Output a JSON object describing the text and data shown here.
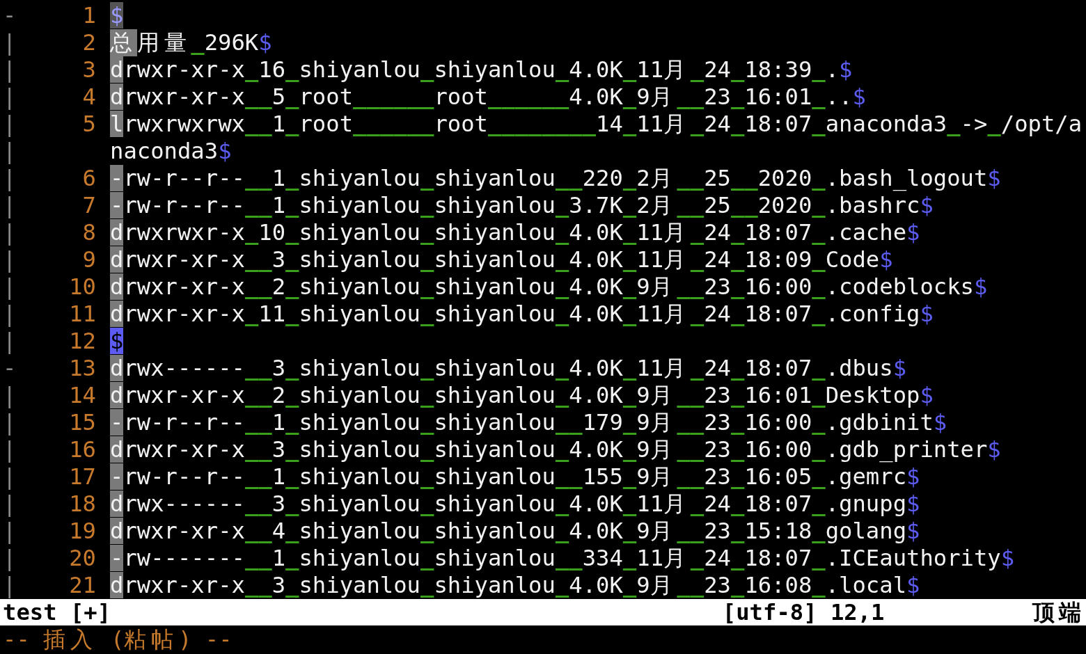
{
  "cursor_column": true,
  "rows": [
    {
      "fold": "-",
      "number": "1",
      "text": "",
      "eol": "$",
      "cursor": false
    },
    {
      "fold": "|",
      "number": "2",
      "text": "总用量 296K",
      "eol": "$",
      "cursor": false
    },
    {
      "fold": "|",
      "number": "3",
      "text": "drwxr-xr-x 16 shiyanlou shiyanlou 4.0K 11月 24 18:39 .",
      "eol": "$",
      "cursor": false
    },
    {
      "fold": "|",
      "number": "4",
      "text": "drwxr-xr-x  5 root      root      4.0K 9月  23 16:01 ..",
      "eol": "$",
      "cursor": false
    },
    {
      "fold": "|",
      "number": "5",
      "text": "lrwxrwxrwx  1 root      root        14 11月 24 18:07 anaconda3 -> /opt/a",
      "cursor": false
    },
    {
      "fold": "|",
      "text": "naconda3",
      "eol": "$"
    },
    {
      "fold": "|",
      "number": "6",
      "text": "-rw-r--r--  1 shiyanlou shiyanlou  220 2月  25  2020 .bash_logout",
      "eol": "$",
      "cursor": false
    },
    {
      "fold": "|",
      "number": "7",
      "text": "-rw-r--r--  1 shiyanlou shiyanlou 3.7K 2月  25  2020 .bashrc",
      "eol": "$",
      "cursor": false
    },
    {
      "fold": "|",
      "number": "8",
      "text": "drwxrwxr-x 10 shiyanlou shiyanlou 4.0K 11月 24 18:07 .cache",
      "eol": "$",
      "cursor": false
    },
    {
      "fold": "|",
      "number": "9",
      "text": "drwxr-xr-x  3 shiyanlou shiyanlou 4.0K 11月 24 18:09 Code",
      "eol": "$",
      "cursor": false
    },
    {
      "fold": "|",
      "number": "10",
      "text": "drwxr-xr-x  2 shiyanlou shiyanlou 4.0K 9月  23 16:00 .codeblocks",
      "eol": "$",
      "cursor": false
    },
    {
      "fold": "|",
      "number": "11",
      "text": "drwxr-xr-x 11 shiyanlou shiyanlou 4.0K 11月 24 18:07 .config",
      "eol": "$",
      "cursor": false
    },
    {
      "fold": "|",
      "number": "12",
      "text": "",
      "eol": "$",
      "cursor": true
    },
    {
      "fold": "-",
      "number": "13",
      "text": "drwx------  3 shiyanlou shiyanlou 4.0K 11月 24 18:07 .dbus",
      "eol": "$",
      "cursor": false
    },
    {
      "fold": "|",
      "number": "14",
      "text": "drwxr-xr-x  2 shiyanlou shiyanlou 4.0K 9月  23 16:01 Desktop",
      "eol": "$",
      "cursor": false
    },
    {
      "fold": "|",
      "number": "15",
      "text": "-rw-r--r--  1 shiyanlou shiyanlou  179 9月  23 16:00 .gdbinit",
      "eol": "$",
      "cursor": false
    },
    {
      "fold": "|",
      "number": "16",
      "text": "drwxr-xr-x  3 shiyanlou shiyanlou 4.0K 9月  23 16:00 .gdb_printer",
      "eol": "$",
      "cursor": false
    },
    {
      "fold": "|",
      "number": "17",
      "text": "-rw-r--r--  1 shiyanlou shiyanlou  155 9月  23 16:05 .gemrc",
      "eol": "$",
      "cursor": false
    },
    {
      "fold": "|",
      "number": "18",
      "text": "drwx------  3 shiyanlou shiyanlou 4.0K 11月 24 18:07 .gnupg",
      "eol": "$",
      "cursor": false
    },
    {
      "fold": "|",
      "number": "19",
      "text": "drwxr-xr-x  4 shiyanlou shiyanlou 4.0K 9月  23 15:18 golang",
      "eol": "$",
      "cursor": false
    },
    {
      "fold": "|",
      "number": "20",
      "text": "-rw-------  1 shiyanlou shiyanlou  334 11月 24 18:07 .ICEauthority",
      "eol": "$",
      "cursor": false
    },
    {
      "fold": "|",
      "number": "21",
      "text": "drwxr-xr-x  3 shiyanlou shiyanlou 4.0K 9月  23 16:08 .local",
      "eol": "$",
      "cursor": false
    }
  ],
  "status_bar": {
    "file": "test [+]",
    "position": "[utf-8] 12,1",
    "scroll": "顶端"
  },
  "mode_line": "-- 插入 (粘帖) --"
}
